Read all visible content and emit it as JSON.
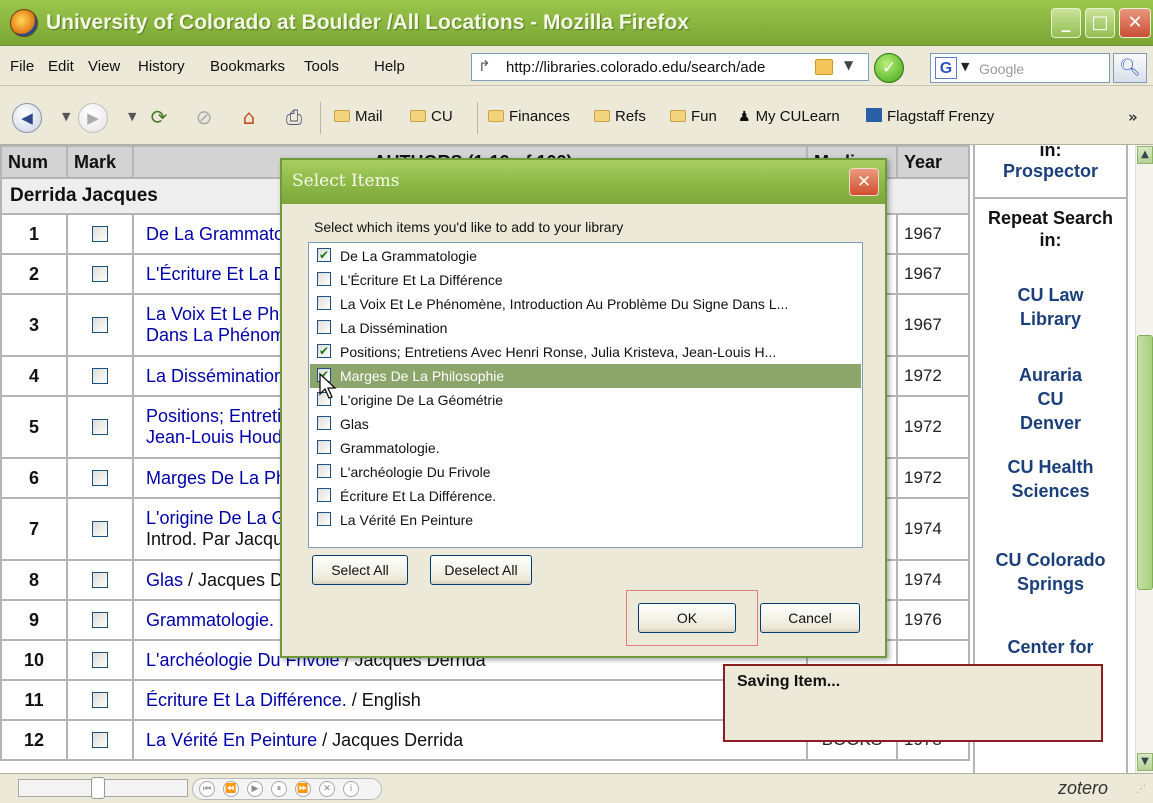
{
  "window": {
    "title": "University of Colorado at Boulder /All Locations - Mozilla Firefox"
  },
  "menu": [
    "File",
    "Edit",
    "View",
    "History",
    "Bookmarks",
    "Tools",
    "Help"
  ],
  "address": {
    "url": "http://libraries.colorado.edu/search/ade"
  },
  "search": {
    "placeholder": "Google"
  },
  "bookmarks": [
    "Mail",
    "CU",
    "Finances",
    "Refs",
    "Fun",
    "My CULearn",
    "Flagstaff Frenzy"
  ],
  "table": {
    "col_num": "Num",
    "col_mark": "Mark",
    "col_authors": "AUTHORS (1-12 of 102)",
    "col_medium": "Medium",
    "col_year": "Year",
    "group": "Derrida Jacques",
    "rows": [
      {
        "num": "1",
        "title": "De La Grammatologie",
        "author": "",
        "medium": "",
        "year": "1967"
      },
      {
        "num": "2",
        "title": "L'Écriture Et La Différence",
        "author": "",
        "medium": "",
        "year": "1967"
      },
      {
        "num": "3",
        "title": "La Voix Et Le Phénomène, Introduction Au Problème Du Signe",
        "title2": "Dans La Phénoménologie",
        "author": "",
        "medium": "",
        "year": "1967"
      },
      {
        "num": "4",
        "title": "La Dissémination",
        "author": "",
        "medium": "",
        "year": "1972"
      },
      {
        "num": "5",
        "title": "Positions; Entretiens Avec Henri Ronse, Julia Kristeva,",
        "title2": "Jean-Louis Houdebine",
        "author": "",
        "medium": "",
        "year": "1972"
      },
      {
        "num": "6",
        "title": "Marges De La Philosophie",
        "author": "",
        "medium": "",
        "year": "1972"
      },
      {
        "num": "7",
        "title": "L'origine De La Géométrie",
        "title2": "Introd. Par Jacques Derrida",
        "author": "",
        "medium": "",
        "year": "1974"
      },
      {
        "num": "8",
        "title": "Glas",
        "author": " / Jacques Derrida",
        "medium": "",
        "year": "1974"
      },
      {
        "num": "9",
        "title": "Grammatologie.",
        "author": "",
        "medium": "",
        "year": "1976"
      },
      {
        "num": "10",
        "title": "L'archéologie Du Frivole",
        "author": " / Jacques Derrida",
        "medium": "",
        "year": ""
      },
      {
        "num": "11",
        "title": "Écriture Et La Différence.",
        "author": " / English",
        "medium": "",
        "year": ""
      },
      {
        "num": "12",
        "title": "La Vérité En Peinture",
        "author": " / Jacques Derrida",
        "medium": "BOOKS",
        "year": "1978"
      }
    ]
  },
  "sidebar": {
    "top_partial": "in:",
    "prospector": "Prospector",
    "repeat": "Repeat Search in:",
    "links": [
      "CU Law Library",
      "Auraria CU Denver",
      "CU Health Sciences",
      "CU Colorado Springs",
      "Center for"
    ]
  },
  "dialog": {
    "title": "Select Items",
    "instruction": "Select which items you'd like to add to your library",
    "items": [
      {
        "label": "De La Grammatologie",
        "checked": true
      },
      {
        "label": "L'Écriture Et La Différence",
        "checked": false
      },
      {
        "label": "La Voix Et Le Phénomène, Introduction Au Problème Du Signe Dans L...",
        "checked": false
      },
      {
        "label": "La Dissémination",
        "checked": false
      },
      {
        "label": "Positions; Entretiens Avec Henri Ronse, Julia Kristeva, Jean-Louis H...",
        "checked": true
      },
      {
        "label": "Marges De La Philosophie",
        "checked": true,
        "selected": true
      },
      {
        "label": "L'origine De La Géométrie",
        "checked": false
      },
      {
        "label": "Glas",
        "checked": false
      },
      {
        "label": "Grammatologie.",
        "checked": false
      },
      {
        "label": "L'archéologie Du Frivole",
        "checked": false
      },
      {
        "label": "Écriture Et La Différence.",
        "checked": false
      },
      {
        "label": "La Vérité En Peinture",
        "checked": false
      }
    ],
    "select_all": "Select All",
    "deselect_all": "Deselect All",
    "ok": "OK",
    "cancel": "Cancel"
  },
  "saving": {
    "text": "Saving Item..."
  },
  "status": {
    "brand": "zotero"
  }
}
